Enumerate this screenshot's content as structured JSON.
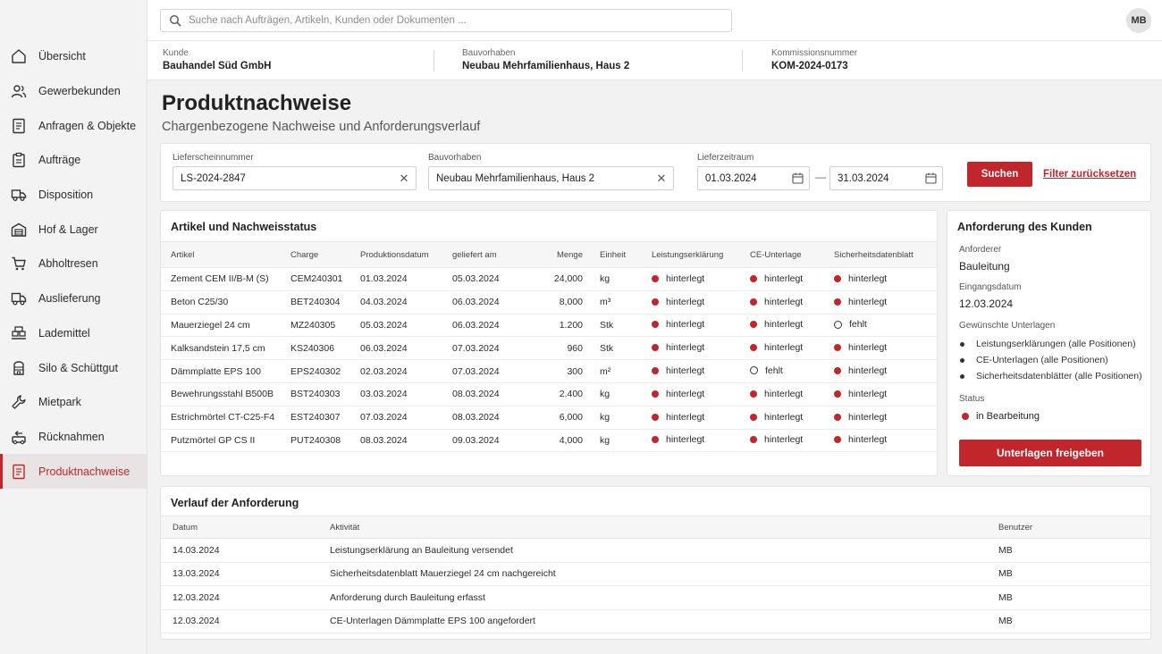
{
  "sidebar": {
    "items": [
      {
        "label": "Übersicht",
        "icon": "home-icon"
      },
      {
        "label": "Gewerbekunden",
        "icon": "users-icon"
      },
      {
        "label": "Anfragen & Objekte",
        "icon": "document-icon"
      },
      {
        "label": "Aufträge",
        "icon": "clipboard-icon"
      },
      {
        "label": "Disposition",
        "icon": "truck-icon"
      },
      {
        "label": "Hof & Lager",
        "icon": "warehouse-icon"
      },
      {
        "label": "Abholtresen",
        "icon": "cart-icon"
      },
      {
        "label": "Auslieferung",
        "icon": "delivery-truck-icon"
      },
      {
        "label": "Lademittel",
        "icon": "pallet-icon"
      },
      {
        "label": "Silo & Schüttgut",
        "icon": "silo-icon"
      },
      {
        "label": "Mietpark",
        "icon": "wrench-icon"
      },
      {
        "label": "Rücknahmen",
        "icon": "return-icon"
      },
      {
        "label": "Produktnachweise",
        "icon": "certificate-document-icon",
        "active": true
      }
    ]
  },
  "topbar": {
    "search_placeholder": "Suche nach Aufträgen, Artikeln, Kunden oder Dokumenten ...",
    "avatar_initials": "MB"
  },
  "context": {
    "customer_label": "Kunde",
    "customer_value": "Bauhandel Süd GmbH",
    "project_label": "Bauvorhaben",
    "project_value": "Neubau Mehrfamilienhaus, Haus 2",
    "commission_label": "Kommissionsnummer",
    "commission_value": "KOM-2024-0173"
  },
  "page": {
    "title": "Produktnachweise",
    "subtitle": "Chargenbezogene Nachweise und Anforderungsverlauf"
  },
  "filters": {
    "delivery_note_label": "Lieferscheinnummer",
    "delivery_note_value": "LS-2024-2847",
    "project_label": "Bauvorhaben",
    "project_value": "Neubau Mehrfamilienhaus, Haus 2",
    "period_label": "Lieferzeitraum",
    "date_from": "01.03.2024",
    "date_separator": "—",
    "date_to": "31.03.2024",
    "search_button": "Suchen",
    "reset_link": "Filter zurücksetzen",
    "clear_symbol": "✕"
  },
  "articles": {
    "title": "Artikel und Nachweisstatus",
    "columns": [
      "Artikel",
      "Charge",
      "Produktionsdatum",
      "geliefert am",
      "Menge",
      "Einheit",
      "Leistungserklärung",
      "CE-Unterlage",
      "Sicherheitsdatenblatt"
    ],
    "rows": [
      {
        "artikel": "Zement CEM II/B-M (S)",
        "charge": "CEM240301",
        "produktion": "01.03.2024",
        "geliefert": "05.03.2024",
        "menge": "24,000",
        "einheit": "kg",
        "le": "hinterlegt",
        "ce": "hinterlegt",
        "sdb": "hinterlegt"
      },
      {
        "artikel": "Beton C25/30",
        "charge": "BET240304",
        "produktion": "04.03.2024",
        "geliefert": "06.03.2024",
        "menge": "8,000",
        "einheit": "m³",
        "le": "hinterlegt",
        "ce": "hinterlegt",
        "sdb": "hinterlegt"
      },
      {
        "artikel": "Mauerziegel 24 cm",
        "charge": "MZ240305",
        "produktion": "05.03.2024",
        "geliefert": "06.03.2024",
        "menge": "1.200",
        "einheit": "Stk",
        "le": "hinterlegt",
        "ce": "hinterlegt",
        "sdb": "fehlt"
      },
      {
        "artikel": "Kalksandstein 17,5 cm",
        "charge": "KS240306",
        "produktion": "06.03.2024",
        "geliefert": "07.03.2024",
        "menge": "960",
        "einheit": "Stk",
        "le": "hinterlegt",
        "ce": "hinterlegt",
        "sdb": "hinterlegt"
      },
      {
        "artikel": "Dämmplatte EPS 100",
        "charge": "EPS240302",
        "produktion": "02.03.2024",
        "geliefert": "07.03.2024",
        "menge": "300",
        "einheit": "m²",
        "le": "hinterlegt",
        "ce": "fehlt",
        "sdb": "hinterlegt"
      },
      {
        "artikel": "Bewehrungsstahl B500B",
        "charge": "BST240303",
        "produktion": "03.03.2024",
        "geliefert": "08.03.2024",
        "menge": "2.400",
        "einheit": "kg",
        "le": "hinterlegt",
        "ce": "hinterlegt",
        "sdb": "hinterlegt"
      },
      {
        "artikel": "Estrichmörtel CT-C25-F4",
        "charge": "EST240307",
        "produktion": "07.03.2024",
        "geliefert": "08.03.2024",
        "menge": "6,000",
        "einheit": "kg",
        "le": "hinterlegt",
        "ce": "hinterlegt",
        "sdb": "hinterlegt"
      },
      {
        "artikel": "Putzmörtel GP CS II",
        "charge": "PUT240308",
        "produktion": "08.03.2024",
        "geliefert": "09.03.2024",
        "menge": "4,000",
        "einheit": "kg",
        "le": "hinterlegt",
        "ce": "hinterlegt",
        "sdb": "hinterlegt"
      }
    ]
  },
  "request": {
    "title": "Anforderung des Kunden",
    "requester_label": "Anforderer",
    "requester_value": "Bauleitung",
    "received_label": "Eingangsdatum",
    "received_value": "12.03.2024",
    "documents_label": "Gewünschte Unterlagen",
    "documents": [
      "Leistungserklärungen (alle Positionen)",
      "CE-Unterlagen (alle Positionen)",
      "Sicherheitsdatenblätter (alle Positionen)"
    ],
    "status_label": "Status",
    "status_value": "in Bearbeitung",
    "release_button": "Unterlagen freigeben"
  },
  "history": {
    "title": "Verlauf der Anforderung",
    "columns": [
      "Datum",
      "Aktivität",
      "Benutzer"
    ],
    "rows": [
      {
        "datum": "14.03.2024",
        "aktivitaet": "Leistungserklärung an Bauleitung versendet",
        "benutzer": "MB"
      },
      {
        "datum": "13.03.2024",
        "aktivitaet": "Sicherheitsdatenblatt Mauerziegel 24 cm nachgereicht",
        "benutzer": "MB"
      },
      {
        "datum": "12.03.2024",
        "aktivitaet": "Anforderung durch Bauleitung erfasst",
        "benutzer": "MB"
      },
      {
        "datum": "12.03.2024",
        "aktivitaet": "CE-Unterlagen Dämmplatte EPS 100 angefordert",
        "benutzer": "MB"
      }
    ]
  },
  "colors": {
    "accent": "#c0262b",
    "status_present": "#c0262b"
  }
}
